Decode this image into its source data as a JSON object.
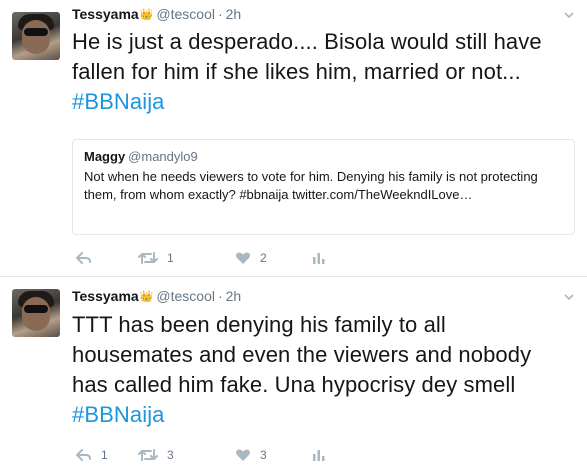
{
  "tweets": [
    {
      "name": "Tessyama",
      "crown": "👑",
      "handle": "@tescool",
      "separator": "·",
      "time": "2h",
      "text_main": "He is just a desperado....  Bisola would still have fallen for him if she likes him, married or not... ",
      "hashtag": "#BBNaija",
      "quote": {
        "name": "Maggy",
        "handle": "@mandylo9",
        "text": "Not when he needs viewers to vote for him. Denying his family is not protecting them, from whom exactly? #bbnaija twitter.com/TheWeekndILove…"
      },
      "actions": {
        "reply": "",
        "retweet": "1",
        "like": "2"
      }
    },
    {
      "name": "Tessyama",
      "crown": "👑",
      "handle": "@tescool",
      "separator": "·",
      "time": "2h",
      "text_main": "TTT has been denying his family to all housemates and even the viewers and nobody has called him fake.  Una hypocrisy dey smell ",
      "hashtag": "#BBNaija",
      "actions": {
        "reply": "1",
        "retweet": "3",
        "like": "3"
      }
    }
  ],
  "colors": {
    "text": "#14171a",
    "secondary": "#657786",
    "icon": "#aab8c2",
    "link": "#1b95e0",
    "border": "#e1e8ed"
  }
}
